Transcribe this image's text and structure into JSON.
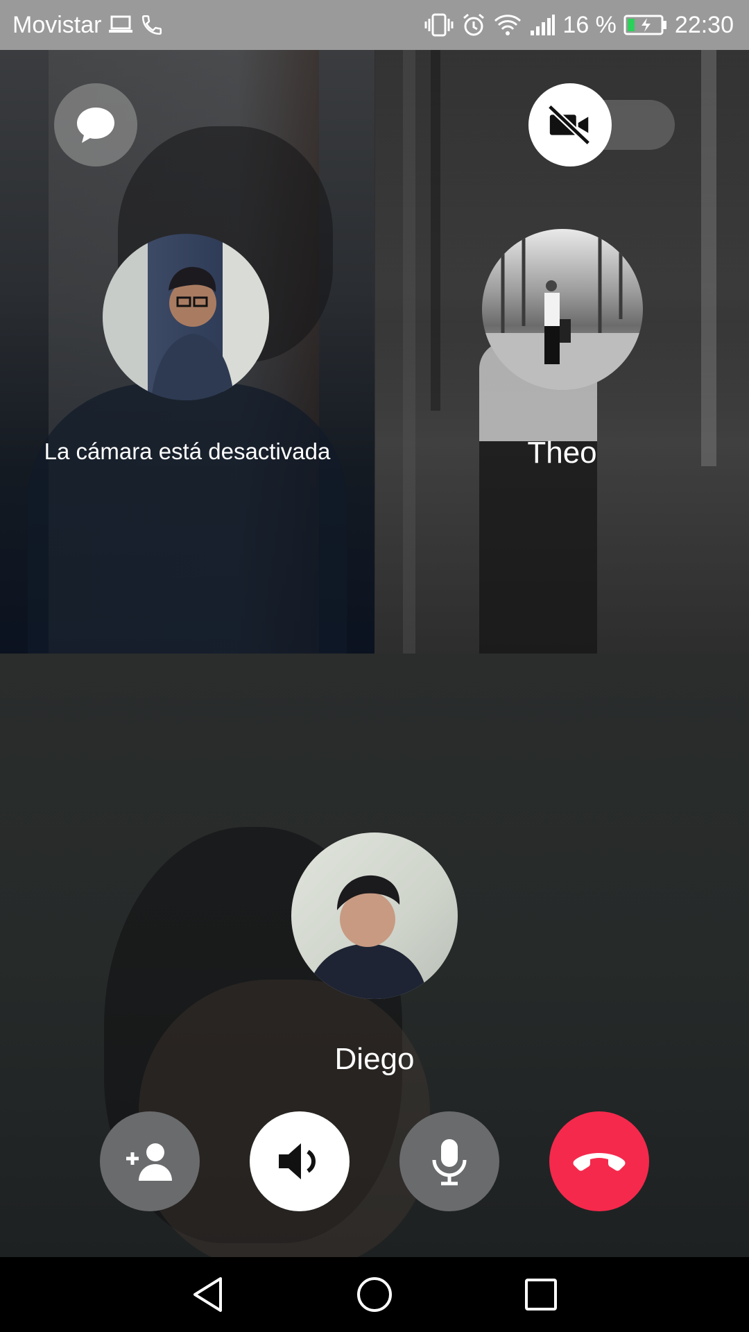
{
  "status_bar": {
    "carrier": "Movistar",
    "battery_percent": "16 %",
    "time": "22:30",
    "icons": [
      "laptop-icon",
      "phone-icon",
      "vibrate-icon",
      "alarm-icon",
      "wifi-icon",
      "signal-icon",
      "battery-charging-icon"
    ]
  },
  "call": {
    "participants": [
      {
        "tile": "top-left",
        "label": "La cámara está desactivada"
      },
      {
        "tile": "top-right",
        "label": "Theo"
      },
      {
        "tile": "bottom",
        "label": "Diego"
      }
    ],
    "top_buttons": [
      "chat-icon",
      "video-off-icon"
    ],
    "controls": [
      "add-person-icon",
      "speaker-icon",
      "microphone-icon",
      "end-call-icon"
    ]
  },
  "colors": {
    "end_call": "#f5294c",
    "status_bar": "#9a9a9a",
    "button_gray": "#6a6b6d",
    "button_white": "#ffffff"
  },
  "nav_bar": {
    "icons": [
      "back-icon",
      "home-icon",
      "recents-icon"
    ]
  }
}
